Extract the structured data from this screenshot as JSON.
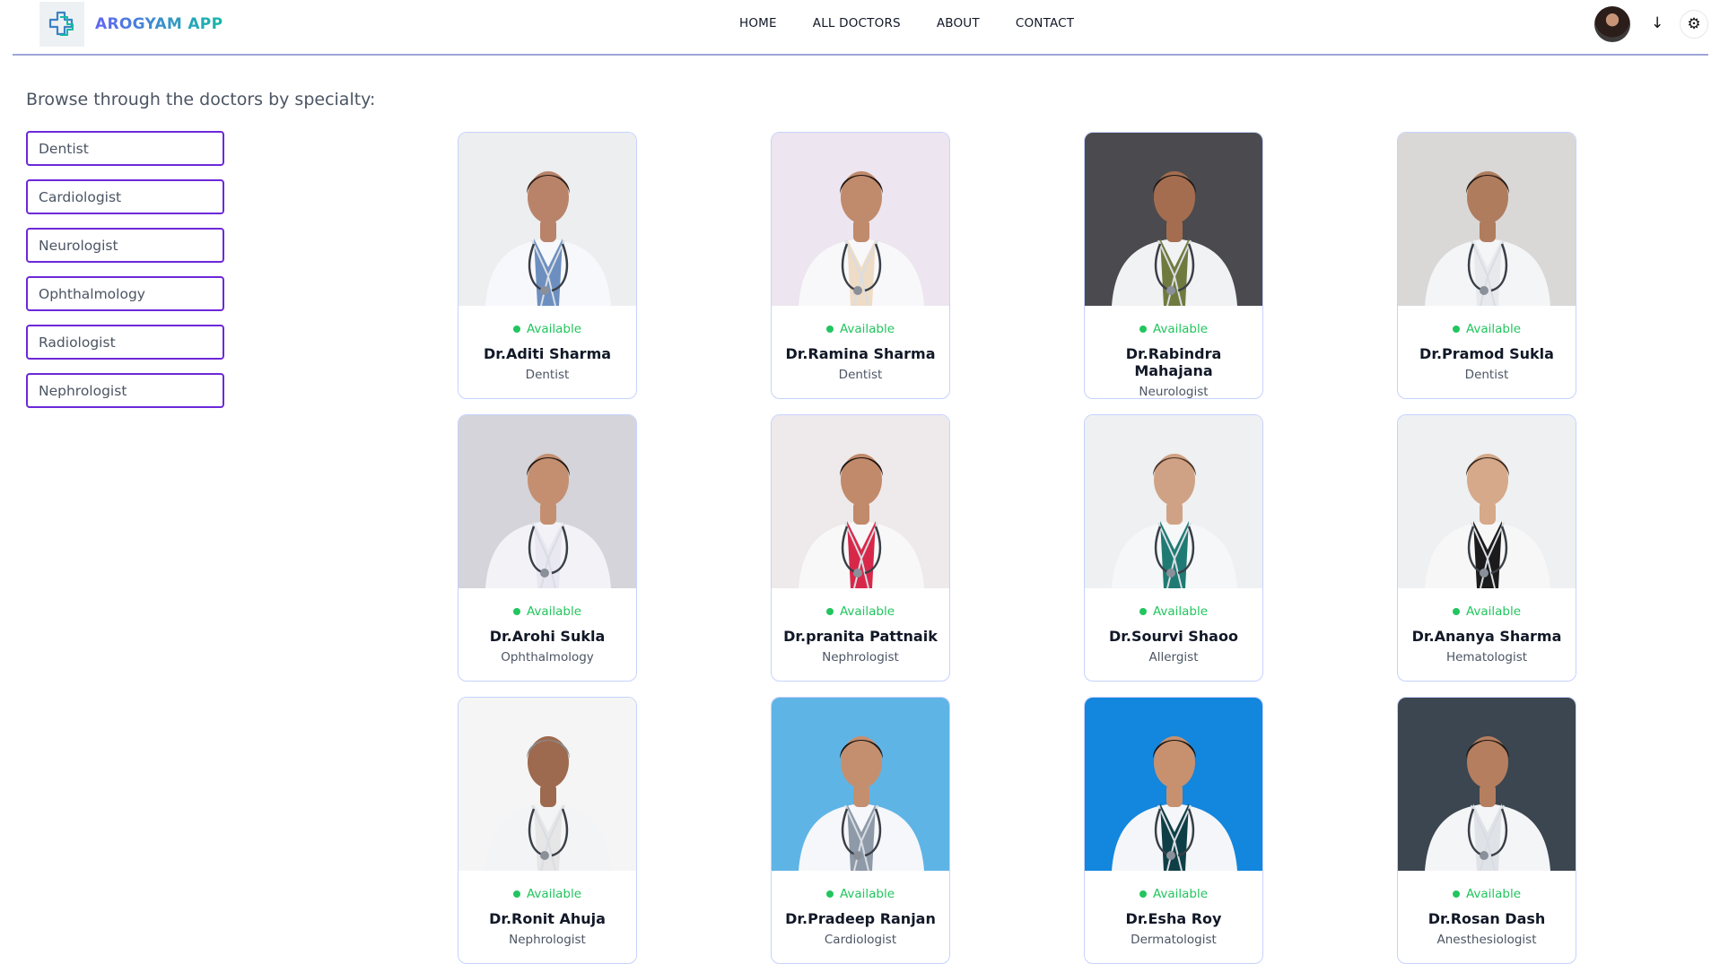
{
  "app": {
    "name": "AROGYAM APP"
  },
  "nav": [
    "HOME",
    "ALL DOCTORS",
    "ABOUT",
    "CONTACT"
  ],
  "header_icons": {
    "logo": "medical-cross-logo",
    "avatar": "user-avatar",
    "dropdown": "arrow-down-icon",
    "settings": "gear-icon"
  },
  "sidebar": {
    "heading": "Browse through the doctors by specialty:",
    "filters": [
      "Dentist",
      "Cardiologist",
      "Neurologist",
      "Ophthalmology",
      "Radiologist",
      "Nephrologist"
    ]
  },
  "colors": {
    "accent": "#6d28d9",
    "available": "#22c55e",
    "card_border": "#c7d2fe"
  },
  "doctors": [
    {
      "status": "Available",
      "name": "Dr.Aditi Sharma",
      "specialty": "Dentist",
      "bg": "#eceef0",
      "skin": "#b9836a",
      "hair": "#2b1d16",
      "coat": "#f7f8fb",
      "inner": "#6d8fc0"
    },
    {
      "status": "Available",
      "name": "Dr.Ramina Sharma",
      "specialty": "Dentist",
      "bg": "#ede5ef",
      "skin": "#c08a6c",
      "hair": "#1d1512",
      "coat": "#f8f8fa",
      "inner": "#efdcc6"
    },
    {
      "status": "Available",
      "name": "Dr.Rabindra Mahajana",
      "specialty": "Neurologist",
      "bg": "#4b4b4f",
      "skin": "#a56d4f",
      "hair": "#1b1a1a",
      "coat": "#f1f2f3",
      "inner": "#6f7b3e"
    },
    {
      "status": "Available",
      "name": "Dr.Pramod Sukla",
      "specialty": "Dentist",
      "bg": "#d9d8d6",
      "skin": "#b07c5e",
      "hair": "#231a16",
      "coat": "#f4f5f7",
      "inner": "#e7e9ed"
    },
    {
      "status": "Available",
      "name": "Dr.Arohi Sukla",
      "specialty": "Ophthalmology",
      "bg": "#d4d4da",
      "skin": "#c48f70",
      "hair": "#1f1714",
      "coat": "#f3f3f7",
      "inner": "#e9e7f1"
    },
    {
      "status": "Available",
      "name": "Dr.pranita Pattnaik",
      "specialty": "Nephrologist",
      "bg": "#eee9ea",
      "skin": "#c18a6b",
      "hair": "#1a1311",
      "coat": "#f8f8f8",
      "inner": "#d8284a"
    },
    {
      "status": "Available",
      "name": "Dr.Sourvi Shaoo",
      "specialty": "Allergist",
      "bg": "#eef0f2",
      "skin": "#d0a285",
      "hair": "#4a3325",
      "coat": "#f5f7f9",
      "inner": "#1f7a73"
    },
    {
      "status": "Available",
      "name": "Dr.Ananya Sharma",
      "specialty": "Hematologist",
      "bg": "#eef0f1",
      "skin": "#d5a989",
      "hair": "#3a2a22",
      "coat": "#f7f7f8",
      "inner": "#1b1b1b"
    },
    {
      "status": "Available",
      "name": "Dr.Ronit Ahuja",
      "specialty": "Nephrologist",
      "bg": "#f5f5f5",
      "skin": "#9d6a4f",
      "hair": "#8b8b8b",
      "coat": "#f3f4f6",
      "inner": "#e6e6e6"
    },
    {
      "status": "Available",
      "name": "Dr.Pradeep Ranjan",
      "specialty": "Cardiologist",
      "bg": "#5fb4e6",
      "skin": "#c48f6f",
      "hair": "#1b1614",
      "coat": "#f5f7fa",
      "inner": "#8e9aa8"
    },
    {
      "status": "Available",
      "name": "Dr.Esha Roy",
      "specialty": "Dermatologist",
      "bg": "#1386de",
      "skin": "#c7916f",
      "hair": "#1a1311",
      "coat": "#f4f6f9",
      "inner": "#0f3f46"
    },
    {
      "status": "Available",
      "name": "Dr.Rosan Dash",
      "specialty": "Anesthesiologist",
      "bg": "#3b4650",
      "skin": "#b57e5f",
      "hair": "#1f1915",
      "coat": "#f4f5f7",
      "inner": "#dfe3e8"
    }
  ]
}
